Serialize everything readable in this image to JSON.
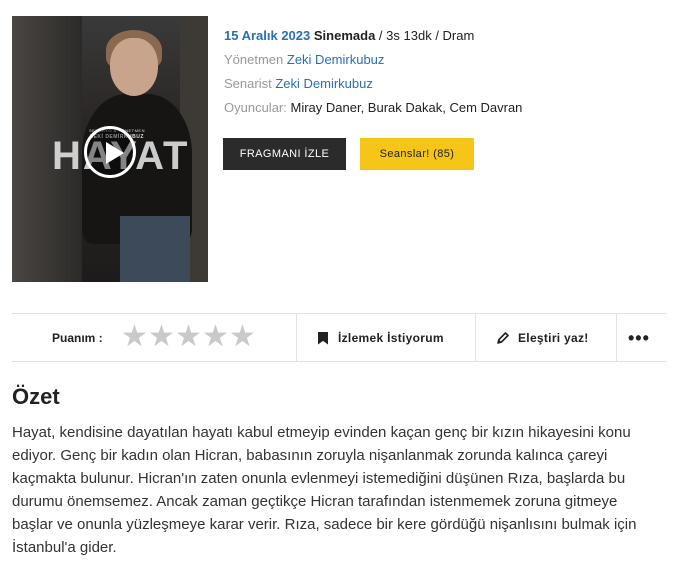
{
  "movie": {
    "poster_title": "HAYAT",
    "poster_credits_line1": "SENARYO & YÖNETMEN",
    "poster_credits_line2": "ZEKİ DEMİRKUBUZ",
    "release_date": "15 Aralık 2023",
    "status": "Sinemada",
    "duration": "3s 13dk",
    "genre": "Dram",
    "separator": " / ",
    "director_label": "Yönetmen",
    "director": "Zeki Demirkubuz",
    "writer_label": "Senarist",
    "writer": "Zeki Demirkubuz",
    "cast_label": "Oyuncular:",
    "cast": "Miray Daner, Burak Dakak, Cem Davran"
  },
  "buttons": {
    "trailer": "FRAGMANI İZLE",
    "sessions": "Seanslar! (85)"
  },
  "rating_bar": {
    "label": "Puanım :",
    "stars": [
      "★",
      "★",
      "★",
      "★",
      "★"
    ],
    "watchlist": "İzlemek İstiyorum",
    "review": "Eleştiri yaz!",
    "more": "•••"
  },
  "summary": {
    "title": "Özet",
    "text": "Hayat, kendisine dayatılan hayatı kabul etmeyip evinden kaçan genç bir kızın hikayesini konu ediyor. Genç bir kadın olan Hicran, babasının zoruyla nişanlanmak zorunda kalınca çareyi kaçmakta bulunur. Hicran'ın zaten onunla evlenmeyi istemediğini düşünen Rıza, başlarda bu durumu önemsemez. Ancak zaman geçtikçe Hicran tarafından istenmemek zoruna gitmeye başlar ve onunla yüzleşmeye karar verir. Rıza, sadece bir kere gördüğü nişanlısını bulmak için İstanbul'a gider."
  },
  "colors": {
    "link": "#2a6fb0",
    "accent_yellow": "#f5c518",
    "dark_button": "#2b2b2b",
    "star_inactive": "#c9c9c9"
  }
}
